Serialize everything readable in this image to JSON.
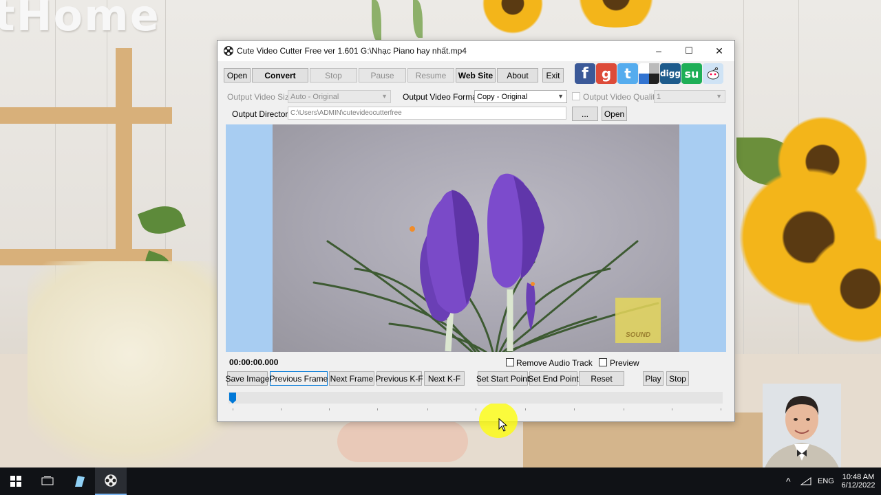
{
  "window": {
    "title": "Cute Video Cutter Free ver 1.601  G:\\Nhạc Piano hay nhất.mp4",
    "minimize": "–",
    "maximize": "☐",
    "close": "✕"
  },
  "toolbar": {
    "open": "Open",
    "convert": "Convert",
    "stop": "Stop",
    "pause": "Pause",
    "resume": "Resume",
    "website": "Web Site",
    "about": "About",
    "exit": "Exit"
  },
  "social": [
    "facebook-icon",
    "google-icon",
    "twitter-icon",
    "delicious-icon",
    "digg-icon",
    "stumbleupon-icon",
    "reddit-icon"
  ],
  "social_labels": {
    "facebook": "f",
    "google": "g",
    "twitter": "t",
    "digg": "digg",
    "stumbleupon": "su"
  },
  "options": {
    "output_size_label": "Output Video Size:",
    "output_size_value": "Auto - Original",
    "output_format_label": "Output Video Format:",
    "output_format_value": "Copy - Original",
    "output_quality_label": "Output Video Quality",
    "output_quality_value": "1",
    "output_dir_label": "Output Directory:",
    "output_dir_value": "C:\\Users\\ADMIN\\cutevideocutterfree",
    "browse": "...",
    "open_dir": "Open"
  },
  "video": {
    "watermark": "SOUND"
  },
  "playback": {
    "timecode": "00:00:00.000",
    "remove_audio": "Remove Audio Track",
    "preview": "Preview",
    "save_image": "Save Image",
    "previous_frame": "Previous Frame",
    "next_frame": "Next Frame",
    "previous_kf": "Previous K-F",
    "next_kf": "Next K-F",
    "set_start": "Set  Start Point",
    "set_end": "Set  End Point",
    "reset": "Reset",
    "play": "Play",
    "stop": "Stop",
    "slider_position": 0
  },
  "wallpaper": {
    "text": "tHome"
  },
  "taskbar": {
    "language": "ENG",
    "time": "10:48 AM",
    "date": "6/12/2022",
    "tray_arrow": "^"
  },
  "colors": {
    "video_bg": "#a8cdf2",
    "accent": "#0078d7",
    "highlight": "#ffff00"
  }
}
